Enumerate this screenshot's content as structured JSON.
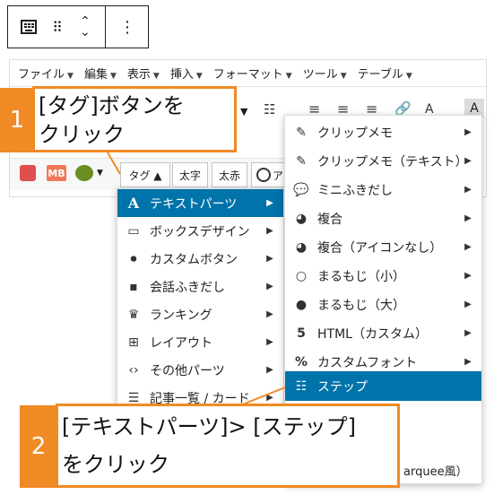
{
  "block_toolbar": {
    "classic_icon": "classic-block-icon",
    "drag_icon": "⠿",
    "move_up": "⌃",
    "move_down": "⌄",
    "options_icon": "⋮"
  },
  "menubar": {
    "items": [
      "ファイル",
      "編集",
      "表示",
      "挿入",
      "フォーマット",
      "ツール",
      "テーブル"
    ]
  },
  "toolbar_row3": {
    "tag_button": "タグ ▲",
    "bold_button": "太字",
    "red_bold_button": "太赤",
    "partial_button": "ア"
  },
  "tag_menu": {
    "items": [
      {
        "icon": "A",
        "label": "テキストパーツ",
        "active": true
      },
      {
        "icon": "▭",
        "label": "ボックスデザイン"
      },
      {
        "icon": "⏺",
        "label": "カスタムボタン"
      },
      {
        "icon": "▪",
        "label": "会話ふきだし"
      },
      {
        "icon": "♛",
        "label": "ランキング"
      },
      {
        "icon": "⊞",
        "label": "レイアウト"
      },
      {
        "icon": "‹›",
        "label": "その他パーツ"
      },
      {
        "icon": "☰",
        "label": "記事一覧 / カード"
      }
    ]
  },
  "text_parts_menu": {
    "items": [
      {
        "icon": "✎",
        "label": "クリップメモ"
      },
      {
        "icon": "✎",
        "label": "クリップメモ（テキスト）"
      },
      {
        "icon": "💬",
        "label": "ミニふきだし"
      },
      {
        "icon": "◕",
        "label": "複合"
      },
      {
        "icon": "◕",
        "label": "複合（アイコンなし）"
      },
      {
        "icon": "○",
        "label": "まるもじ（小）"
      },
      {
        "icon": "●",
        "label": "まるもじ（大）"
      },
      {
        "icon": "5",
        "label": "HTML（カスタム）"
      },
      {
        "icon": "%",
        "label": "カスタムフォント"
      },
      {
        "icon": "☷",
        "label": "ステップ",
        "active": true
      },
      {
        "icon": "",
        "label": "arquee風）",
        "partial": true
      }
    ]
  },
  "callouts": {
    "one": {
      "number": "1",
      "line1": "[タグ]ボタンを",
      "line2": "クリック"
    },
    "two": {
      "number": "2",
      "line1": "[テキストパーツ]> [ステップ]",
      "line2": "をクリック"
    }
  },
  "colors": {
    "accent": "#f08a24",
    "active": "#0073aa"
  }
}
